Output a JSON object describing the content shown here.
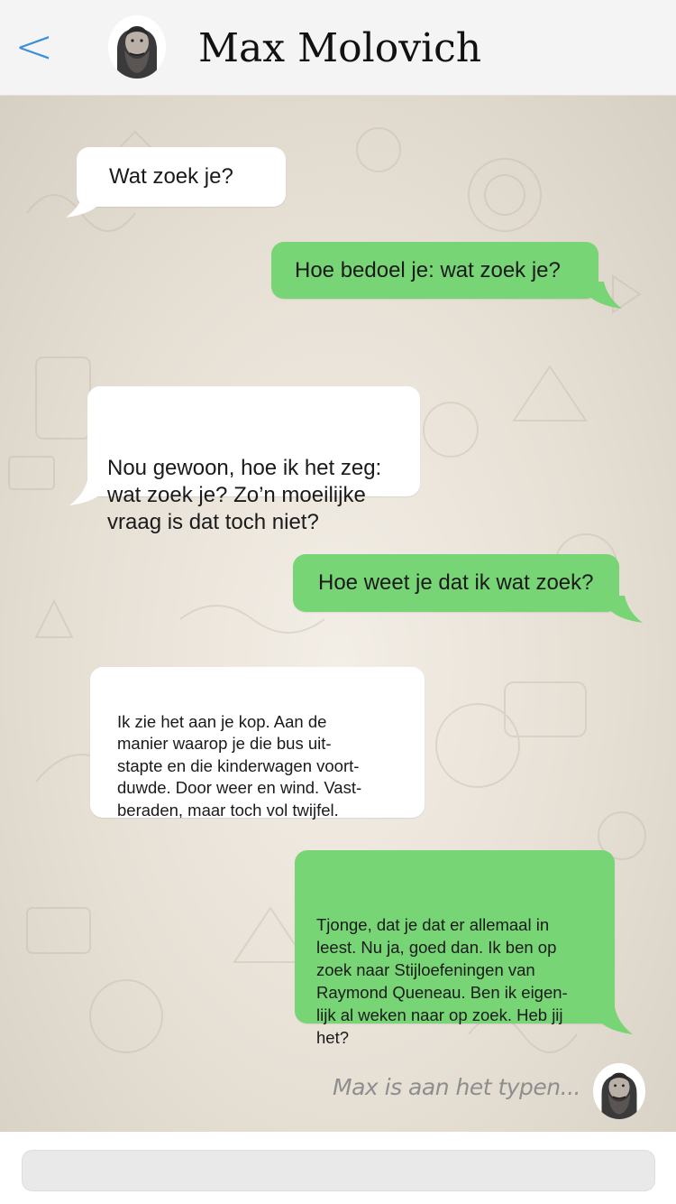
{
  "header": {
    "back_label": "<",
    "contact_name": "Max Molovich"
  },
  "messages": [
    {
      "direction": "in",
      "text": "Wat zoek je?"
    },
    {
      "direction": "out",
      "text": "Hoe bedoel je: wat zoek je?"
    },
    {
      "direction": "in",
      "text": "Nou gewoon, hoe ik het zeg:\nwat zoek je? Zo’n moeilijke\nvraag is dat toch niet?"
    },
    {
      "direction": "out",
      "text": "Hoe weet je dat ik wat zoek?"
    },
    {
      "direction": "in",
      "text": "Ik zie het aan je kop. Aan de\nmanier waarop je die bus uit-\nstapte en die kinderwagen voort-\nduwde. Door weer en wind. Vast-\nberaden, maar toch vol twijfel."
    },
    {
      "direction": "out",
      "text": "Tjonge, dat je dat er allemaal in\nleest. Nu ja, goed dan. Ik ben op\nzoek naar Stijloefeningen van\nRaymond Queneau. Ben ik eigen-\nlijk al weken naar op zoek. Heb jij\nhet?"
    }
  ],
  "typing_indicator": "Max is aan het typen...",
  "composer": {
    "placeholder": ""
  },
  "colors": {
    "incoming_bubble": "#ffffff",
    "outgoing_bubble": "#77d576",
    "accent": "#3a8fd6",
    "header_bg": "#f4f4f4"
  },
  "icons": {
    "back": "chevron-left-icon",
    "avatar": "bearded-man-avatar"
  }
}
